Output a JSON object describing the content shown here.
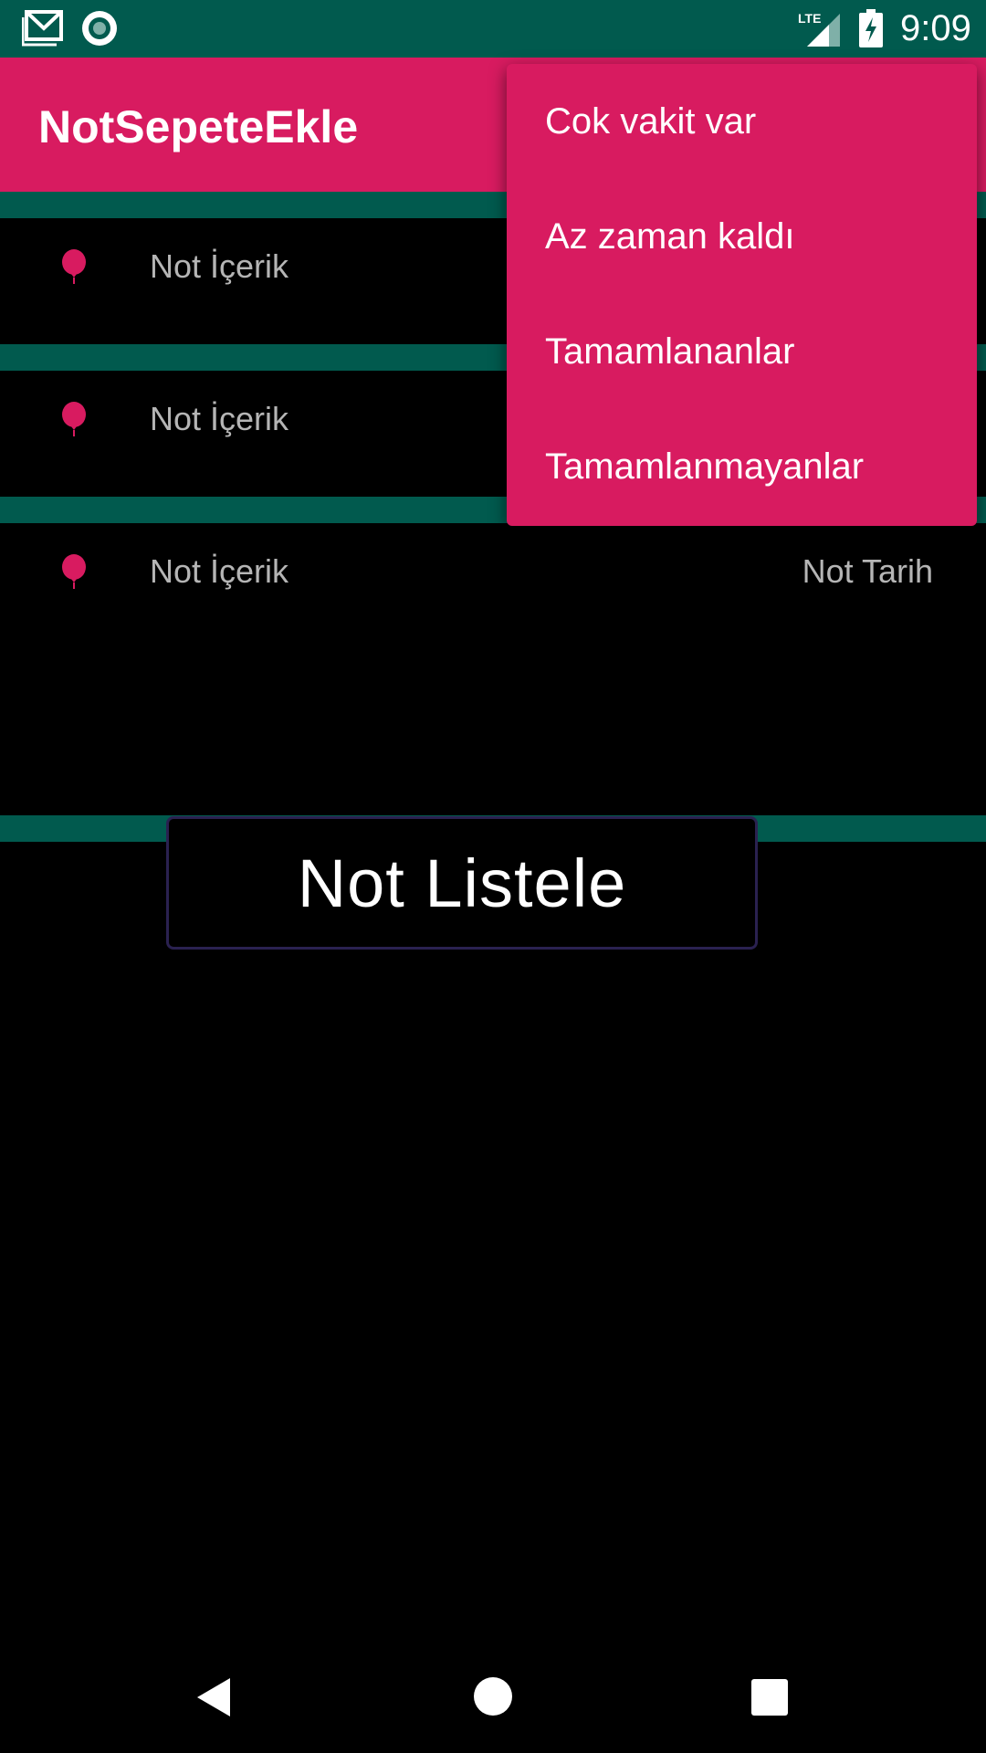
{
  "status_bar": {
    "time": "9:09",
    "network": "LTE",
    "icons": [
      "gmail-icon",
      "sync-icon",
      "lte-signal-icon",
      "battery-charging-icon"
    ],
    "color": "#015a4e"
  },
  "app_bar": {
    "title": "NotSepeteEkle",
    "color": "#d81b60"
  },
  "notes": [
    {
      "content": "Not İçerik",
      "date": ""
    },
    {
      "content": "Not İçerik",
      "date": ""
    },
    {
      "content": "Not İçerik",
      "date": "Not Tarih"
    }
  ],
  "list_button": {
    "label": "Not Listele"
  },
  "popup_menu": {
    "items": [
      {
        "label": "Cok vakit var"
      },
      {
        "label": "Az zaman kaldı"
      },
      {
        "label": "Tamamlananlar"
      },
      {
        "label": "Tamamlanmayanlar"
      }
    ]
  },
  "nav_bar": {
    "icons": [
      "back-icon",
      "home-icon",
      "recent-apps-icon"
    ]
  },
  "colors": {
    "accent": "#d81b60",
    "primary_dark": "#015a4e",
    "background": "#000000",
    "secondary_text": "#b5b5b5"
  }
}
